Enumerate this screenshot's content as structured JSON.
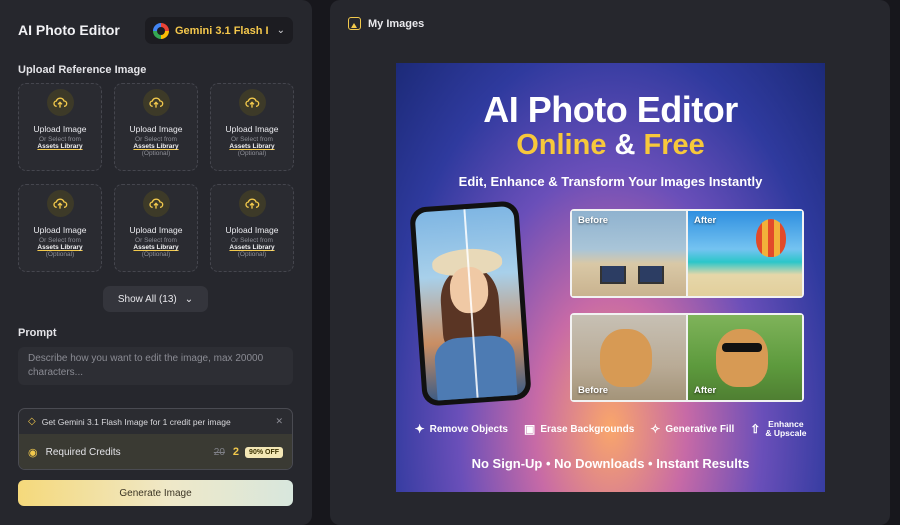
{
  "app": {
    "title": "AI Photo Editor",
    "model_selector": {
      "label": "Gemini 3.1 Flash I...",
      "icon": "google-g-icon"
    }
  },
  "upload": {
    "section_label": "Upload Reference Image",
    "tiles": [
      {
        "title": "Upload Image",
        "sub": "Or Select from",
        "link": "Assets Library",
        "optional": ""
      },
      {
        "title": "Upload Image",
        "sub": "Or Select from",
        "link": "Assets Library",
        "optional": "(Optional)"
      },
      {
        "title": "Upload Image",
        "sub": "Or Select from",
        "link": "Assets Library",
        "optional": "(Optional)"
      },
      {
        "title": "Upload Image",
        "sub": "Or Select from",
        "link": "Assets Library",
        "optional": "(Optional)"
      },
      {
        "title": "Upload Image",
        "sub": "Or Select from",
        "link": "Assets Library",
        "optional": "(Optional)"
      },
      {
        "title": "Upload Image",
        "sub": "Or Select from",
        "link": "Assets Library",
        "optional": "(Optional)"
      }
    ],
    "show_all": "Show All (13)"
  },
  "prompt": {
    "label": "Prompt",
    "placeholder": "Describe how you want to edit the image, max 20000 characters..."
  },
  "credits": {
    "promo": "Get Gemini 3.1 Flash Image for 1 credit per image",
    "label": "Required Credits",
    "old_value": "20",
    "new_value": "2",
    "discount": "90% OFF"
  },
  "generate_label": "Generate Image",
  "my_images": {
    "label": "My Images"
  },
  "poster": {
    "title": "AI Photo Editor",
    "sub_a": "Online",
    "sub_amp": " & ",
    "sub_b": "Free",
    "tagline": "Edit, Enhance & Transform Your Images Instantly",
    "before": "Before",
    "after": "After",
    "features": [
      "Remove Objects",
      "Erase Backgrounds",
      "Generative Fill",
      "Enhance",
      "& Upscale"
    ],
    "footer": "No Sign-Up • No Downloads • Instant Results"
  },
  "colors": {
    "accent": "#f2c94c",
    "panel": "#26272d",
    "background": "#17171c"
  }
}
